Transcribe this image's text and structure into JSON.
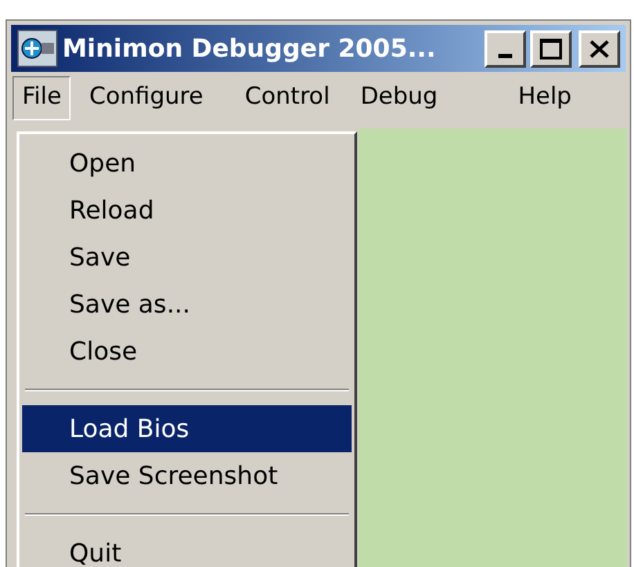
{
  "window": {
    "title": "Minimon Debugger 2005..."
  },
  "menu_bar": [
    {
      "label": "File",
      "selected": true
    },
    {
      "label": "Configure",
      "selected": false
    },
    {
      "label": "Control",
      "selected": false
    },
    {
      "label": "Debug",
      "selected": false
    },
    {
      "label": "Help",
      "selected": false
    }
  ],
  "file_menu": [
    {
      "kind": "item",
      "label": "Open",
      "selected": false
    },
    {
      "kind": "item",
      "label": "Reload",
      "selected": false
    },
    {
      "kind": "item",
      "label": "Save",
      "selected": false
    },
    {
      "kind": "item",
      "label": "Save as...",
      "selected": false
    },
    {
      "kind": "item",
      "label": "Close",
      "selected": false
    },
    {
      "kind": "separator"
    },
    {
      "kind": "item",
      "label": "Load Bios",
      "selected": true
    },
    {
      "kind": "item",
      "label": "Save Screenshot",
      "selected": false
    },
    {
      "kind": "separator"
    },
    {
      "kind": "item",
      "label": "Quit",
      "selected": false
    }
  ]
}
